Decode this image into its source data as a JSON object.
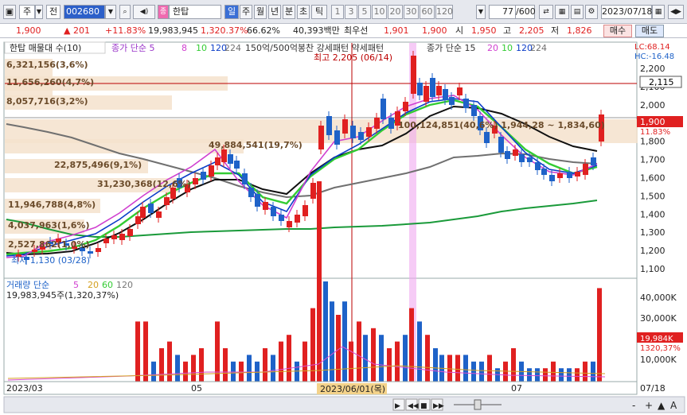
{
  "toolbar": {
    "window_icon": "window-icon",
    "type_label": "주",
    "nav_label": "전",
    "code": "002680",
    "stock_name": "한탑",
    "periods": [
      "일",
      "주",
      "월",
      "년",
      "분",
      "초",
      "틱"
    ],
    "active_period": "일",
    "numbers": [
      "1",
      "3",
      "5",
      "10",
      "20",
      "30",
      "60",
      "120"
    ],
    "count_value": "77",
    "count_total": "/600",
    "date": "2023/07/18"
  },
  "quote": {
    "price": "1,900",
    "change": "▲   201",
    "rate": "+11.83%",
    "volume": "19,983,945",
    "vol_ratio": "1,320.37%",
    "turnover": "66.62%",
    "amount": "40,393백만",
    "broker": "최우선",
    "bid": "1,901",
    "ask": "1,900",
    "open_label": "시",
    "open": "1,950",
    "high_label": "고",
    "high": "2,205",
    "low_label": "저",
    "low": "1,826",
    "buy": "매수",
    "sell": "매도"
  },
  "chart": {
    "legend_stock": "한탑 매물대 수(10)",
    "legend_ma": "종가 단순 5",
    "ma_periods": [
      "8",
      "10",
      "120",
      "224"
    ],
    "legend_pattern": "150억/500억봉찬 강세패턴 약세패턴",
    "legend_ma2": "종가 단순 15",
    "ma2_periods": [
      "20",
      "10",
      "120",
      "224"
    ],
    "lc": "LC:68.14",
    "hc": "HC:-16.48",
    "high_marker": "최고 2,205 (06/14)",
    "low_marker": "최저 1,130 (03/28)",
    "price_tag": "2,115",
    "current_tag": "1,900",
    "current_rate": "11.83%",
    "y_ticks": [
      "2,200",
      "2,100",
      "2,000",
      "1,900",
      "1,800",
      "1,700",
      "1,600",
      "1,500",
      "1,400",
      "1,300",
      "1,200",
      "1,100"
    ],
    "profile": [
      "6,321,156(3,6%)",
      "11,656,260(4,7%)",
      "8,057,716(3,2%)",
      "100,124,851(40,6%) 1,944,28 ~ 1,834,60)",
      "49,884,541(19,7%)",
      "22,875,496(9,1%)",
      "31,230,368(12,6%)",
      "11,946,788(4,8%)",
      "4,037,963(1,6%)",
      "2,527,862(1,0%)"
    ],
    "vol_legend": "거래량 단순",
    "vol_periods": [
      "5",
      "20",
      "60",
      "120"
    ],
    "vol_value": "19,983,945주(1,320,37%)",
    "vol_ticks": [
      "40,000K",
      "30,000K",
      "20,000K",
      "10,000K"
    ],
    "vol_tag": "19,984K",
    "vol_tag_rate": "1320,37%",
    "x_labels": [
      "2023/03",
      "05",
      "07",
      "07/18"
    ],
    "cursor_date": "2023/06/01(목)",
    "colors": {
      "up": "#e02020",
      "down": "#1e62c8",
      "ma5": "#d040d0",
      "ma10": "#0a3cc8",
      "ma20": "#33cc33",
      "ma60": "#101010",
      "ma120": "#707070",
      "ma224": "#1a9a3a",
      "profile": "#f5e2cc",
      "highlight": "#f0a8f0"
    }
  },
  "bottom": {
    "buttons": [
      "▶",
      "◀◀",
      "■",
      "▶▶"
    ],
    "zoom": [
      "-",
      "+",
      "▲",
      "A"
    ]
  }
}
